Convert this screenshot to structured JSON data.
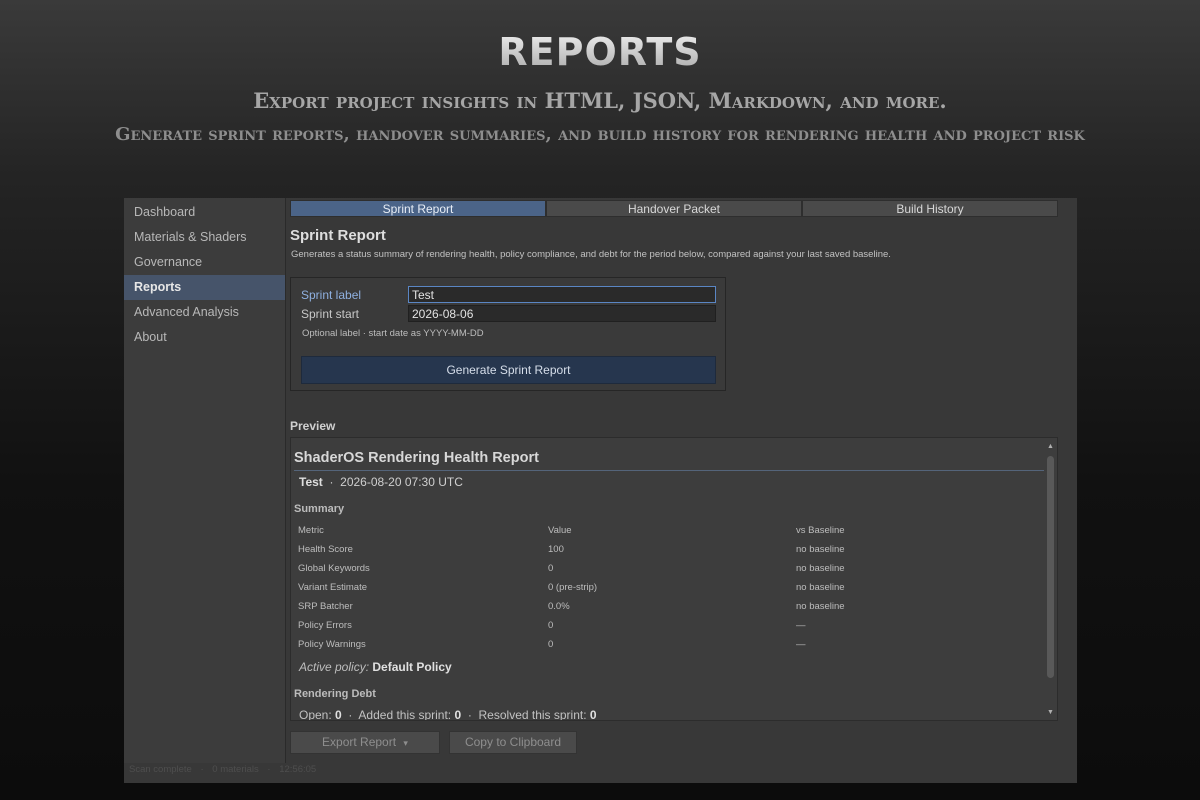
{
  "hero": {
    "title": "REPORTS",
    "subtitle": "Export project insights in HTML, JSON, Markdown, and more.",
    "tagline": "Generate sprint reports, handover summaries, and build history for rendering health and project risk"
  },
  "sidebar": {
    "items": [
      {
        "label": "Dashboard"
      },
      {
        "label": "Materials & Shaders"
      },
      {
        "label": "Governance"
      },
      {
        "label": "Reports",
        "active": true
      },
      {
        "label": "Advanced Analysis"
      },
      {
        "label": "About"
      }
    ]
  },
  "tabs": [
    {
      "label": "Sprint Report",
      "active": true
    },
    {
      "label": "Handover Packet"
    },
    {
      "label": "Build History"
    }
  ],
  "section": {
    "title": "Sprint Report",
    "description": "Generates a status summary of rendering health, policy compliance, and debt for the period below, compared against your last saved baseline."
  },
  "form": {
    "label_field": {
      "label": "Sprint label",
      "value": "Test"
    },
    "start_field": {
      "label": "Sprint start",
      "value": "2026-08-06"
    },
    "hint": "Optional label · start date as YYYY-MM-DD",
    "generate_label": "Generate Sprint Report"
  },
  "preview": {
    "label": "Preview",
    "report_title": "ShaderOS Rendering Health Report",
    "meta_label": "Test",
    "meta_sep": "·",
    "meta_time": "2026-08-20 07:30 UTC",
    "summary_heading": "Summary",
    "columns": [
      "Metric",
      "Value",
      "vs Baseline"
    ],
    "rows": [
      [
        "Health Score",
        "100",
        "no baseline"
      ],
      [
        "Global Keywords",
        "0",
        "no baseline"
      ],
      [
        "Variant Estimate",
        "0 (pre-strip)",
        "no baseline"
      ],
      [
        "SRP Batcher",
        "0.0%",
        "no baseline"
      ],
      [
        "Policy Errors",
        "0",
        "—"
      ],
      [
        "Policy Warnings",
        "0",
        "—"
      ]
    ],
    "policy_prefix": "Active policy:",
    "policy_value": "Default Policy",
    "debt_heading": "Rendering Debt",
    "debt": {
      "open_label": "Open:",
      "open_value": "0",
      "added_label": "Added this sprint:",
      "added_value": "0",
      "resolved_label": "Resolved this sprint:",
      "resolved_value": "0",
      "sep": "·"
    }
  },
  "actions": {
    "export_label": "Export Report",
    "export_caret": "▾",
    "copy_label": "Copy to Clipboard"
  },
  "status": {
    "scan": "Scan complete",
    "materials": "0 materials",
    "sep": "·",
    "time": "12:56:05"
  }
}
